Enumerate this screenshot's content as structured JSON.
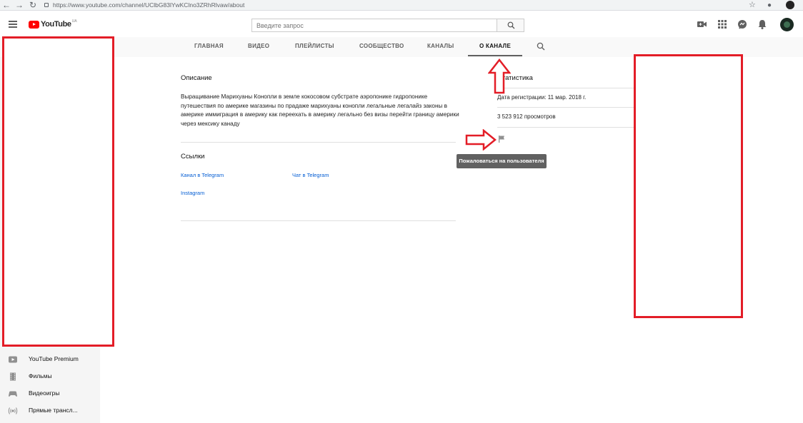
{
  "browser": {
    "url": "https://www.youtube.com/channel/UClbG83lYwKClno3ZRhRlvaw/about",
    "back_icon": "arrow-left-icon",
    "forward_icon": "arrow-right-icon",
    "reload_icon": "reload-icon",
    "star_icon": "star-icon"
  },
  "header": {
    "logo_text": "YouTube",
    "logo_country": "UA",
    "search_placeholder": "Введите запрос",
    "icons": [
      "menu-icon",
      "search-icon",
      "create-video-icon",
      "apps-icon",
      "messages-icon",
      "notifications-icon"
    ]
  },
  "tabs": [
    {
      "label": "ГЛАВНАЯ",
      "active": false
    },
    {
      "label": "ВИДЕО",
      "active": false
    },
    {
      "label": "ПЛЕЙЛИСТЫ",
      "active": false
    },
    {
      "label": "СООБЩЕСТВО",
      "active": false
    },
    {
      "label": "КАНАЛЫ",
      "active": false
    },
    {
      "label": "О КАНАЛЕ",
      "active": true
    }
  ],
  "about": {
    "description_heading": "Описание",
    "description": "Выращивание Марихуаны Конопли в земле кокосовом субстрате аэропонике гидропонике путешествия по америке магазины по прадаже марихуаны конопли легальные легалайз законы в америке иммиграция в америку как переехать в америку легально без визы перейти границу америки через мексику канаду",
    "links_heading": "Ссылки",
    "links": [
      {
        "label": "Канал в Telegram"
      },
      {
        "label": "Чат в Telegram"
      },
      {
        "label": "Instagram"
      }
    ]
  },
  "stats": {
    "heading": "Статистика",
    "joined": "Дата регистрации: 11 мар. 2018 г.",
    "views": "3 523 912 просмотров",
    "report_icon": "flag-icon",
    "report_tooltip": "Пожаловаться на пользователя"
  },
  "sidebar": {
    "items": [
      {
        "label": "YouTube Premium",
        "icon": "youtube-icon"
      },
      {
        "label": "Фильмы",
        "icon": "film-icon"
      },
      {
        "label": "Видеоигры",
        "icon": "gamepad-icon"
      },
      {
        "label": "Прямые трансл...",
        "icon": "live-icon"
      }
    ]
  },
  "colors": {
    "accent_red": "#ff0000",
    "annotation_red": "#e31d27",
    "link_blue": "#065fd4",
    "tooltip_bg": "#616161"
  }
}
